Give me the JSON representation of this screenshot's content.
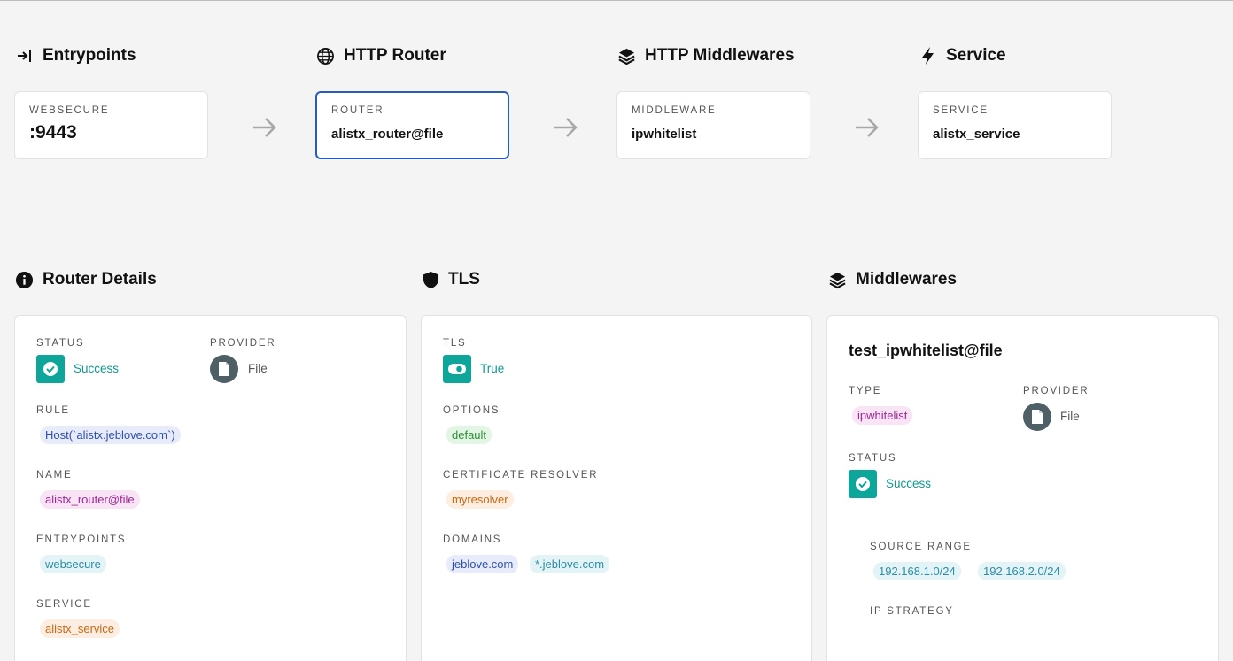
{
  "flow": {
    "entrypoints": {
      "heading": "Entrypoints",
      "label": "WEBSECURE",
      "value": ":9443"
    },
    "router": {
      "heading": "HTTP Router",
      "label": "ROUTER",
      "value": "alistx_router@file"
    },
    "middlewares": {
      "heading": "HTTP Middlewares",
      "label": "MIDDLEWARE",
      "value": "ipwhitelist"
    },
    "service": {
      "heading": "Service",
      "label": "SERVICE",
      "value": "alistx_service"
    }
  },
  "router_details": {
    "heading": "Router Details",
    "status_label": "STATUS",
    "status_value": "Success",
    "provider_label": "PROVIDER",
    "provider_value": "File",
    "rule_label": "RULE",
    "rule_value": "Host(`alistx.jeblove.com`)",
    "name_label": "NAME",
    "name_value": "alistx_router@file",
    "entrypoints_label": "ENTRYPOINTS",
    "entrypoints_value": "websecure",
    "service_label": "SERVICE",
    "service_value": "alistx_service"
  },
  "tls": {
    "heading": "TLS",
    "tls_label": "TLS",
    "tls_value": "True",
    "options_label": "OPTIONS",
    "options_value": "default",
    "resolver_label": "CERTIFICATE RESOLVER",
    "resolver_value": "myresolver",
    "domains_label": "DOMAINS",
    "domains": [
      "jeblove.com",
      "*.jeblove.com"
    ]
  },
  "middlewares_panel": {
    "heading": "Middlewares",
    "title": "test_ipwhitelist@file",
    "type_label": "TYPE",
    "type_value": "ipwhitelist",
    "provider_label": "PROVIDER",
    "provider_value": "File",
    "status_label": "STATUS",
    "status_value": "Success",
    "source_range_label": "SOURCE RANGE",
    "source_ranges": [
      "192.168.1.0/24",
      "192.168.2.0/24"
    ],
    "ip_strategy_label": "IP STRATEGY"
  },
  "colors": {
    "accent": "#2b5cb5",
    "success": "#0ea59a",
    "provider_icon": "#4f5f66"
  }
}
